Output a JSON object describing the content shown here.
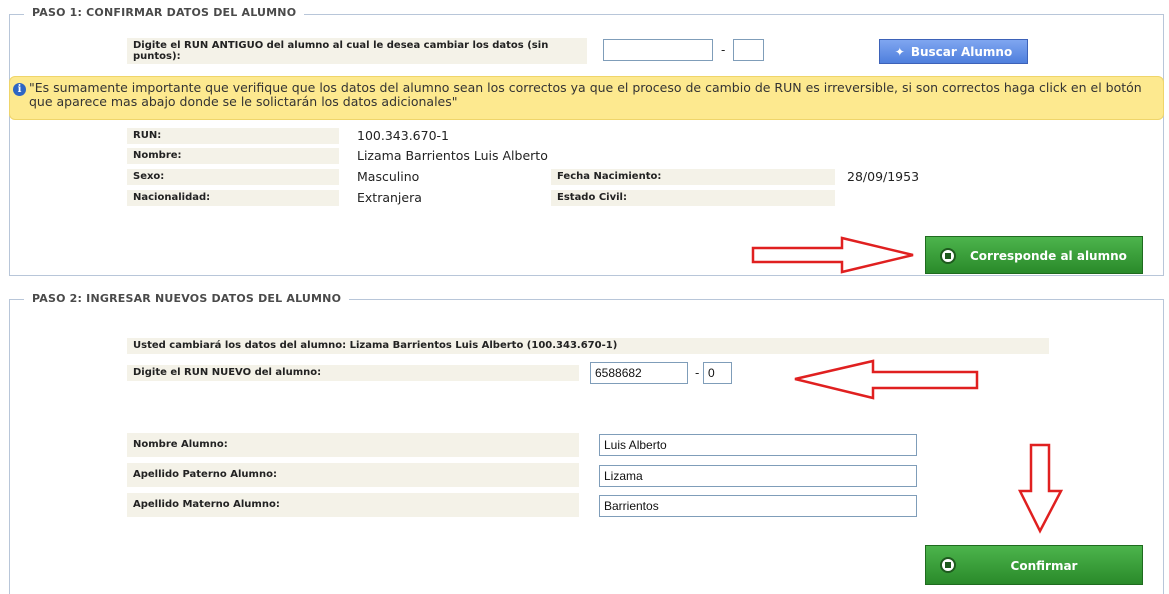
{
  "step1": {
    "legend": "PASO 1: CONFIRMAR DATOS DEL ALUMNO",
    "old_run_label": "Digite el RUN ANTIGUO del alumno al cual le desea cambiar los datos (sin puntos):",
    "old_run_value": "",
    "old_dv_value": "",
    "dash": "-",
    "search_button": "Buscar Alumno",
    "warning": "\"Es sumamente importante que verifique que los datos del alumno sean los correctos ya que el proceso de cambio de RUN es irreversible, si son correctos haga click en el botón que aparece mas abajo donde se le solictarán los datos adicionales\"",
    "fields": {
      "run_label": "RUN:",
      "run_value": "100.343.670-1",
      "nombre_label": "Nombre:",
      "nombre_value": "Lizama Barrientos Luis Alberto",
      "sexo_label": "Sexo:",
      "sexo_value": "Masculino",
      "fecha_label": "Fecha Nacimiento:",
      "fecha_value": "28/09/1953",
      "nacionalidad_label": "Nacionalidad:",
      "nacionalidad_value": "Extranjera",
      "estado_label": "Estado Civil:",
      "estado_value": ""
    },
    "confirm_button": "Corresponde al alumno"
  },
  "step2": {
    "legend": "PASO 2: INGRESAR NUEVOS DATOS DEL ALUMNO",
    "notice": "Usted cambiará los datos del alumno: Lizama Barrientos Luis Alberto (100.343.670-1)",
    "new_run_label": "Digite el RUN NUEVO del alumno:",
    "new_run_value": "6588682",
    "new_dv_value": "0",
    "dash": "-",
    "nombre_label": "Nombre Alumno:",
    "nombre_value": "Luis Alberto",
    "paterno_label": "Apellido Paterno Alumno:",
    "paterno_value": "Lizama",
    "materno_label": "Apellido Materno Alumno:",
    "materno_value": "Barrientos",
    "confirm_button": "Confirmar"
  },
  "colors": {
    "annotation_red": "#e02020",
    "button_green": "#2a8a2a",
    "button_blue": "#4f7fdd",
    "warning_yellow": "#fde98f"
  }
}
